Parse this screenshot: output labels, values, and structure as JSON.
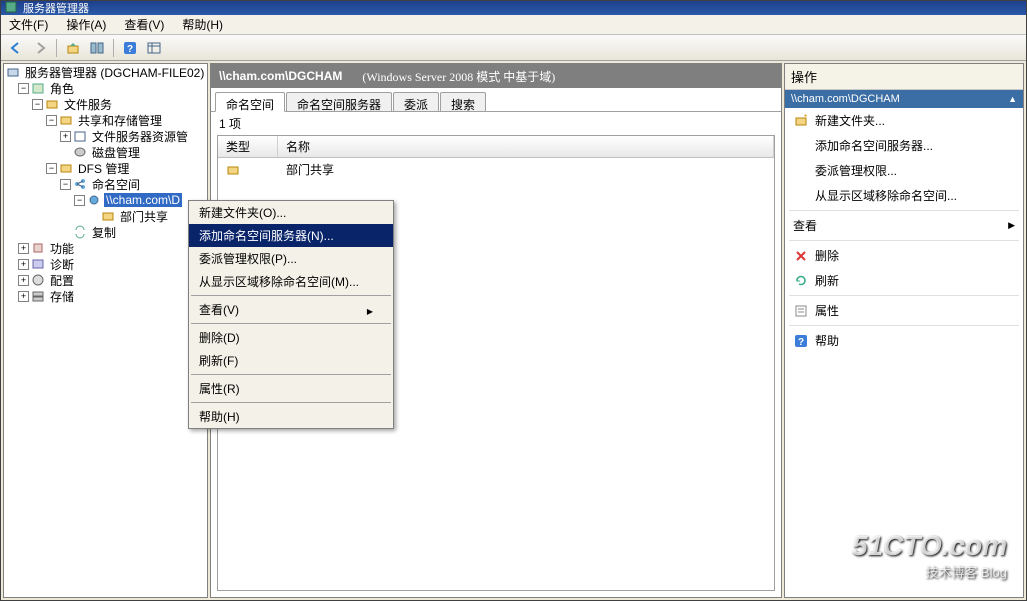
{
  "titlebar": {
    "text": "服务器管理器"
  },
  "menu": {
    "file": "文件(F)",
    "action": "操作(A)",
    "view": "查看(V)",
    "help": "帮助(H)"
  },
  "tree": {
    "root": "服务器管理器 (DGCHAM-FILE02)",
    "roles": "角色",
    "file_service": "文件服务",
    "share_storage": "共享和存储管理",
    "fs_resource": "文件服务器资源管",
    "disk_mgmt": "磁盘管理",
    "dfs_mgmt": "DFS 管理",
    "namespace": "命名空间",
    "ns_path": "\\\\cham.com\\D",
    "dept_share": "部门共享",
    "replication": "复制",
    "features": "功能",
    "diagnostics": "诊断",
    "config": "配置",
    "storage": "存储"
  },
  "main": {
    "path": "\\\\cham.com\\DGCHAM",
    "mode": "(Windows Server 2008 模式 中基于域)",
    "tabs": {
      "ns": "命名空间",
      "ns_servers": "命名空间服务器",
      "delegate": "委派",
      "search": "搜索"
    },
    "count": "1 项",
    "cols": {
      "type": "类型",
      "name": "名称"
    },
    "row1": {
      "name": "部门共享"
    }
  },
  "actions": {
    "title": "操作",
    "sub": "\\\\cham.com\\DGCHAM",
    "new_folder": "新建文件夹...",
    "add_ns_server": "添加命名空间服务器...",
    "delegate_perm": "委派管理权限...",
    "remove_ns": "从显示区域移除命名空间...",
    "view": "查看",
    "delete": "删除",
    "refresh": "刷新",
    "properties": "属性",
    "help": "帮助"
  },
  "ctx": {
    "new_folder": "新建文件夹(O)...",
    "add_ns_server": "添加命名空间服务器(N)...",
    "delegate": "委派管理权限(P)...",
    "remove": "从显示区域移除命名空间(M)...",
    "view": "查看(V)",
    "delete": "删除(D)",
    "refresh": "刷新(F)",
    "properties": "属性(R)",
    "help": "帮助(H)"
  },
  "watermark": {
    "big": "51CTO.com",
    "small": "技术博客   Blog"
  }
}
